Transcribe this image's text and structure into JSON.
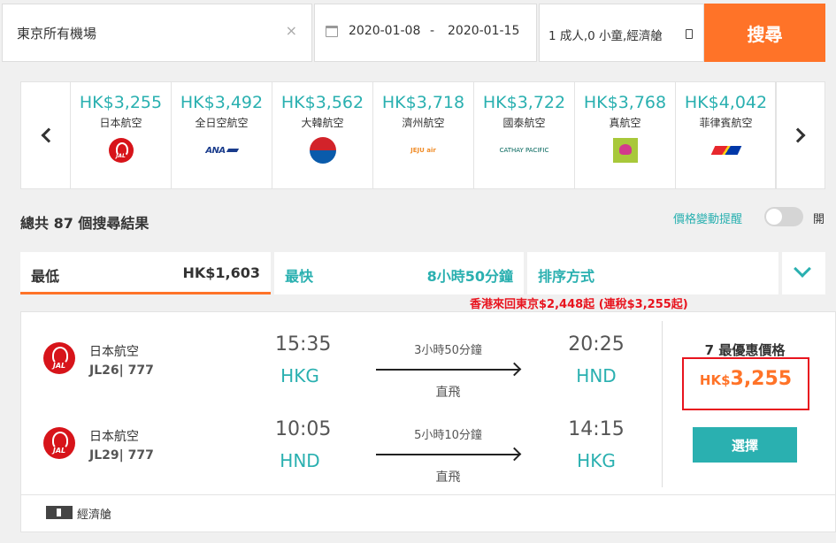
{
  "search": {
    "destination": "東京所有機場",
    "clear_glyph": "×",
    "depart_date": "2020-01-08",
    "date_separator": "-",
    "return_date": "2020-01-15",
    "passengers": "1 成人,0 小童,經濟艙",
    "search_label": "搜尋"
  },
  "airlines": [
    {
      "price": "HK$3,255",
      "name": "日本航空",
      "logo": "jal-logo"
    },
    {
      "price": "HK$3,492",
      "name": "全日空航空",
      "logo": "ana-logo"
    },
    {
      "price": "HK$3,562",
      "name": "大韓航空",
      "logo": "korean-air-logo"
    },
    {
      "price": "HK$3,718",
      "name": "濟州航空",
      "logo": "jeju-air-logo"
    },
    {
      "price": "HK$3,722",
      "name": "國泰航空",
      "logo": "cathay-pacific-logo"
    },
    {
      "price": "HK$3,768",
      "name": "真航空",
      "logo": "peach-logo"
    },
    {
      "price": "HK$4,042",
      "name": "菲律賓航空",
      "logo": "philippine-airlines-logo"
    }
  ],
  "logo_text": {
    "jal": "JAL",
    "ana": "ANA",
    "jeju": "JEJU air",
    "cx": "CATHAY PACIFIC"
  },
  "results": {
    "total": "總共 87 個搜尋結果",
    "price_alert_label": "價格變動提醒",
    "toggle_label": "開"
  },
  "tabs": {
    "cheapest": {
      "label": "最低",
      "meta": "HK$1,603"
    },
    "fastest": {
      "label": "最快",
      "meta": "8小時50分鐘"
    },
    "sort": {
      "label": "排序方式"
    }
  },
  "promo": "香港來回東京$2,448起 (連稅$3,255起)",
  "result": {
    "legs": [
      {
        "airline": "日本航空",
        "flight": "JL26| 777",
        "dep_time": "15:35",
        "dep_code": "HKG",
        "duration": "3小時50分鐘",
        "stops": "直飛",
        "arr_time": "20:25",
        "arr_code": "HND"
      },
      {
        "airline": "日本航空",
        "flight": "JL29| 777",
        "dep_time": "10:05",
        "dep_code": "HND",
        "duration": "5小時10分鐘",
        "stops": "直飛",
        "arr_time": "14:15",
        "arr_code": "HKG"
      }
    ],
    "offers_label": "7 最優惠價格",
    "currency": "HK$",
    "price": "3,255",
    "select_label": "選擇",
    "cabin": "經濟艙"
  },
  "colors": {
    "accent_orange": "#ff7328",
    "teal": "#2ab0b0",
    "promo_red": "#e8141e"
  }
}
